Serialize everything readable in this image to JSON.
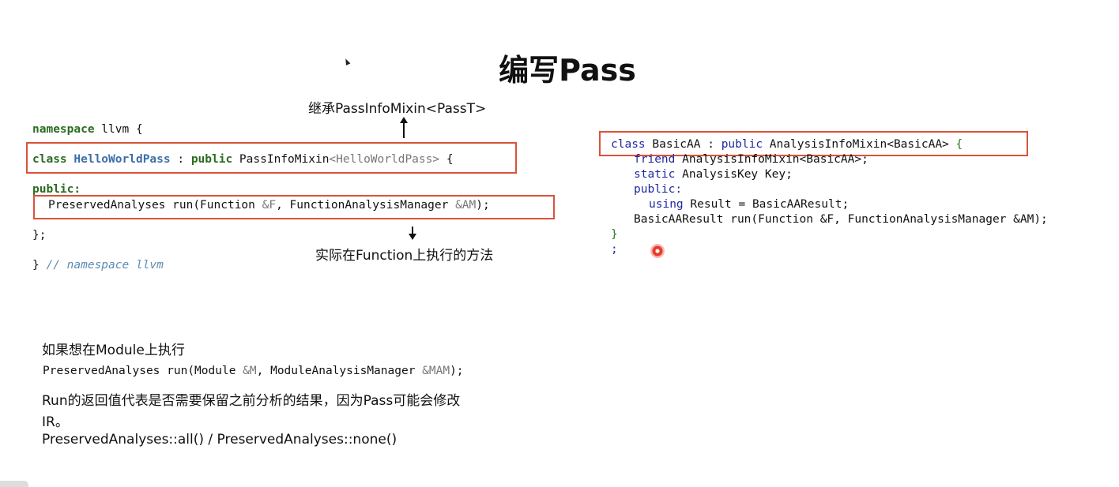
{
  "title": "编写Pass",
  "annotations": {
    "inherit": "继承PassInfoMixin<PassT>",
    "run_on_function": "实际在Function上执行的方法"
  },
  "left_code": {
    "ns_kw": "namespace",
    "ns_name": " llvm {",
    "class_kw": "class",
    "class_name": "HelloWorldPass",
    "class_colon": " : ",
    "public_kw": "public",
    "class_base": " PassInfoMixin",
    "class_tmpl": "<HelloWorldPass>",
    "class_brace": " {",
    "public_label": "public:",
    "run_ret": "PreservedAnalyses run(Function ",
    "run_f": "&F",
    "run_mid": ", FunctionAnalysisManager ",
    "run_am": "&AM",
    "run_end": ");",
    "close_class": "};",
    "close_ns": "}",
    "ns_comment": "// namespace llvm"
  },
  "right_code": {
    "class_kw": "class",
    "class_name": " BasicAA : ",
    "public_kw": "public",
    "base": " AnalysisInfoMixin<BasicAA> ",
    "brace": "{",
    "friend_kw": "friend",
    "friend_rest": " AnalysisInfoMixin<BasicAA>;",
    "static_kw": "static",
    "static_rest": " AnalysisKey Key;",
    "public_label": "public:",
    "using_kw": "using",
    "using_rest": " Result = BasicAAResult;",
    "run_line": "BasicAAResult run(Function &F, FunctionAnalysisManager &AM);",
    "close_brace": "}",
    "semicolon": ";"
  },
  "bottom": {
    "module_title": "如果想在Module上执行",
    "module_sig_a": "PreservedAnalyses run(Module ",
    "module_sig_m": "&M",
    "module_sig_b": ", ModuleAnalysisManager ",
    "module_sig_mam": "&MAM",
    "module_sig_end": ");",
    "desc_line1": "Run的返回值代表是否需要保留之前分析的结果，因为Pass可能会修改",
    "desc_line2": "IR。",
    "desc_line3": "PreservedAnalyses::all() / PreservedAnalyses::none()"
  },
  "colors": {
    "box_border": "#d9533a",
    "keyword_green": "#2b6b20",
    "keyword_blue": "#1f2a9e",
    "class_name_blue": "#3c6ea8",
    "record_red": "#e83a2a"
  }
}
